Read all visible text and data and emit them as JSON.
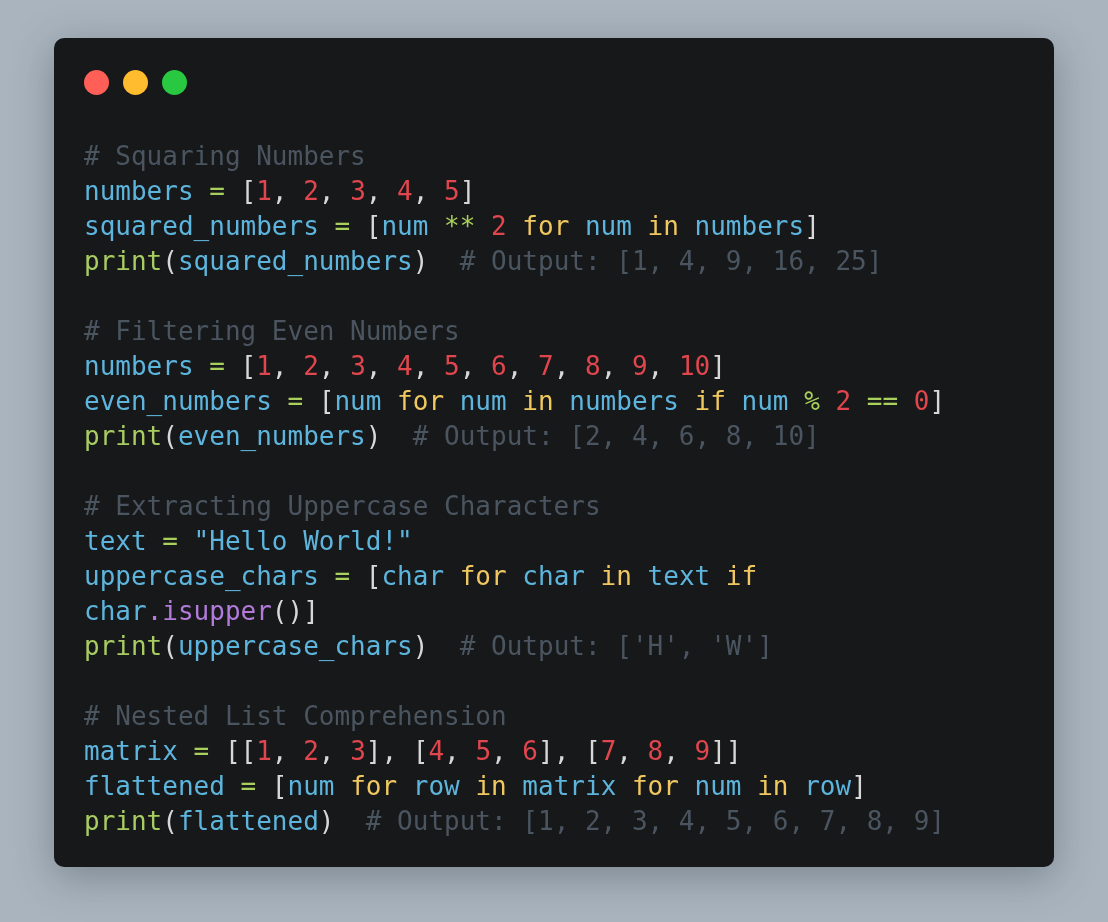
{
  "window": {
    "controls": [
      {
        "color": "#ff5f57"
      },
      {
        "color": "#febc2e"
      },
      {
        "color": "#28c840"
      }
    ]
  },
  "code_lines": [
    {
      "kind": "code",
      "tokens": [
        {
          "kind": "comment",
          "text": "# Squaring Numbers"
        }
      ]
    },
    {
      "kind": "code",
      "tokens": [
        {
          "kind": "name",
          "text": "numbers"
        },
        {
          "kind": "op",
          "text": " = "
        },
        {
          "kind": "punct",
          "text": "["
        },
        {
          "kind": "num",
          "text": "1"
        },
        {
          "kind": "punct",
          "text": ", "
        },
        {
          "kind": "num",
          "text": "2"
        },
        {
          "kind": "punct",
          "text": ", "
        },
        {
          "kind": "num",
          "text": "3"
        },
        {
          "kind": "punct",
          "text": ", "
        },
        {
          "kind": "num",
          "text": "4"
        },
        {
          "kind": "punct",
          "text": ", "
        },
        {
          "kind": "num",
          "text": "5"
        },
        {
          "kind": "punct",
          "text": "]"
        }
      ]
    },
    {
      "kind": "code",
      "tokens": [
        {
          "kind": "name",
          "text": "squared_numbers"
        },
        {
          "kind": "op",
          "text": " = "
        },
        {
          "kind": "punct",
          "text": "["
        },
        {
          "kind": "name",
          "text": "num "
        },
        {
          "kind": "op",
          "text": "**"
        },
        {
          "kind": "num",
          "text": " 2"
        },
        {
          "kind": "kw",
          "text": " for "
        },
        {
          "kind": "name",
          "text": "num"
        },
        {
          "kind": "kw",
          "text": " in "
        },
        {
          "kind": "name",
          "text": "numbers"
        },
        {
          "kind": "punct",
          "text": "]"
        }
      ]
    },
    {
      "kind": "code",
      "tokens": [
        {
          "kind": "fn",
          "text": "print"
        },
        {
          "kind": "punct",
          "text": "("
        },
        {
          "kind": "name",
          "text": "squared_numbers"
        },
        {
          "kind": "punct",
          "text": ")"
        },
        {
          "kind": "comment",
          "text": "  # Output: [1, 4, 9, 16, 25]"
        }
      ]
    },
    {
      "kind": "blank"
    },
    {
      "kind": "code",
      "tokens": [
        {
          "kind": "comment",
          "text": "# Filtering Even Numbers"
        }
      ]
    },
    {
      "kind": "code",
      "tokens": [
        {
          "kind": "name",
          "text": "numbers"
        },
        {
          "kind": "op",
          "text": " = "
        },
        {
          "kind": "punct",
          "text": "["
        },
        {
          "kind": "num",
          "text": "1"
        },
        {
          "kind": "punct",
          "text": ", "
        },
        {
          "kind": "num",
          "text": "2"
        },
        {
          "kind": "punct",
          "text": ", "
        },
        {
          "kind": "num",
          "text": "3"
        },
        {
          "kind": "punct",
          "text": ", "
        },
        {
          "kind": "num",
          "text": "4"
        },
        {
          "kind": "punct",
          "text": ", "
        },
        {
          "kind": "num",
          "text": "5"
        },
        {
          "kind": "punct",
          "text": ", "
        },
        {
          "kind": "num",
          "text": "6"
        },
        {
          "kind": "punct",
          "text": ", "
        },
        {
          "kind": "num",
          "text": "7"
        },
        {
          "kind": "punct",
          "text": ", "
        },
        {
          "kind": "num",
          "text": "8"
        },
        {
          "kind": "punct",
          "text": ", "
        },
        {
          "kind": "num",
          "text": "9"
        },
        {
          "kind": "punct",
          "text": ", "
        },
        {
          "kind": "num",
          "text": "10"
        },
        {
          "kind": "punct",
          "text": "]"
        }
      ]
    },
    {
      "kind": "code",
      "tokens": [
        {
          "kind": "name",
          "text": "even_numbers"
        },
        {
          "kind": "op",
          "text": " = "
        },
        {
          "kind": "punct",
          "text": "["
        },
        {
          "kind": "name",
          "text": "num"
        },
        {
          "kind": "kw",
          "text": " for "
        },
        {
          "kind": "name",
          "text": "num"
        },
        {
          "kind": "kw",
          "text": " in "
        },
        {
          "kind": "name",
          "text": "numbers"
        },
        {
          "kind": "kw",
          "text": " if "
        },
        {
          "kind": "name",
          "text": "num "
        },
        {
          "kind": "op",
          "text": "%"
        },
        {
          "kind": "num",
          "text": " 2"
        },
        {
          "kind": "op",
          "text": " == "
        },
        {
          "kind": "num",
          "text": "0"
        },
        {
          "kind": "punct",
          "text": "]"
        }
      ]
    },
    {
      "kind": "code",
      "tokens": [
        {
          "kind": "fn",
          "text": "print"
        },
        {
          "kind": "punct",
          "text": "("
        },
        {
          "kind": "name",
          "text": "even_numbers"
        },
        {
          "kind": "punct",
          "text": ")"
        },
        {
          "kind": "comment",
          "text": "  # Output: [2, 4, 6, 8, 10]"
        }
      ]
    },
    {
      "kind": "blank"
    },
    {
      "kind": "code",
      "tokens": [
        {
          "kind": "comment",
          "text": "# Extracting Uppercase Characters"
        }
      ]
    },
    {
      "kind": "code",
      "tokens": [
        {
          "kind": "name",
          "text": "text"
        },
        {
          "kind": "op",
          "text": " = "
        },
        {
          "kind": "str",
          "text": "\"Hello World!\""
        }
      ]
    },
    {
      "kind": "code",
      "tokens": [
        {
          "kind": "name",
          "text": "uppercase_chars"
        },
        {
          "kind": "op",
          "text": " = "
        },
        {
          "kind": "punct",
          "text": "["
        },
        {
          "kind": "name",
          "text": "char"
        },
        {
          "kind": "kw",
          "text": " for "
        },
        {
          "kind": "name",
          "text": "char"
        },
        {
          "kind": "kw",
          "text": " in "
        },
        {
          "kind": "name",
          "text": "text"
        },
        {
          "kind": "kw",
          "text": " if"
        }
      ]
    },
    {
      "kind": "code",
      "tokens": [
        {
          "kind": "name",
          "text": "char"
        },
        {
          "kind": "method",
          "text": ".isupper"
        },
        {
          "kind": "punct",
          "text": "()]"
        }
      ]
    },
    {
      "kind": "code",
      "tokens": [
        {
          "kind": "fn",
          "text": "print"
        },
        {
          "kind": "punct",
          "text": "("
        },
        {
          "kind": "name",
          "text": "uppercase_chars"
        },
        {
          "kind": "punct",
          "text": ")"
        },
        {
          "kind": "comment",
          "text": "  # Output: ['H', 'W']"
        }
      ]
    },
    {
      "kind": "blank"
    },
    {
      "kind": "code",
      "tokens": [
        {
          "kind": "comment",
          "text": "# Nested List Comprehension"
        }
      ]
    },
    {
      "kind": "code",
      "tokens": [
        {
          "kind": "name",
          "text": "matrix"
        },
        {
          "kind": "op",
          "text": " = "
        },
        {
          "kind": "punct",
          "text": "[["
        },
        {
          "kind": "num",
          "text": "1"
        },
        {
          "kind": "punct",
          "text": ", "
        },
        {
          "kind": "num",
          "text": "2"
        },
        {
          "kind": "punct",
          "text": ", "
        },
        {
          "kind": "num",
          "text": "3"
        },
        {
          "kind": "punct",
          "text": "], ["
        },
        {
          "kind": "num",
          "text": "4"
        },
        {
          "kind": "punct",
          "text": ", "
        },
        {
          "kind": "num",
          "text": "5"
        },
        {
          "kind": "punct",
          "text": ", "
        },
        {
          "kind": "num",
          "text": "6"
        },
        {
          "kind": "punct",
          "text": "], ["
        },
        {
          "kind": "num",
          "text": "7"
        },
        {
          "kind": "punct",
          "text": ", "
        },
        {
          "kind": "num",
          "text": "8"
        },
        {
          "kind": "punct",
          "text": ", "
        },
        {
          "kind": "num",
          "text": "9"
        },
        {
          "kind": "punct",
          "text": "]]"
        }
      ]
    },
    {
      "kind": "code",
      "tokens": [
        {
          "kind": "name",
          "text": "flattened"
        },
        {
          "kind": "op",
          "text": " = "
        },
        {
          "kind": "punct",
          "text": "["
        },
        {
          "kind": "name",
          "text": "num"
        },
        {
          "kind": "kw",
          "text": " for "
        },
        {
          "kind": "name",
          "text": "row"
        },
        {
          "kind": "kw",
          "text": " in "
        },
        {
          "kind": "name",
          "text": "matrix"
        },
        {
          "kind": "kw",
          "text": " for "
        },
        {
          "kind": "name",
          "text": "num"
        },
        {
          "kind": "kw",
          "text": " in "
        },
        {
          "kind": "name",
          "text": "row"
        },
        {
          "kind": "punct",
          "text": "]"
        }
      ]
    },
    {
      "kind": "code",
      "tokens": [
        {
          "kind": "fn",
          "text": "print"
        },
        {
          "kind": "punct",
          "text": "("
        },
        {
          "kind": "name",
          "text": "flattened"
        },
        {
          "kind": "punct",
          "text": ")"
        },
        {
          "kind": "comment",
          "text": "  # Output: [1, 2, 3, 4, 5, 6, 7, 8, 9]"
        }
      ]
    }
  ]
}
